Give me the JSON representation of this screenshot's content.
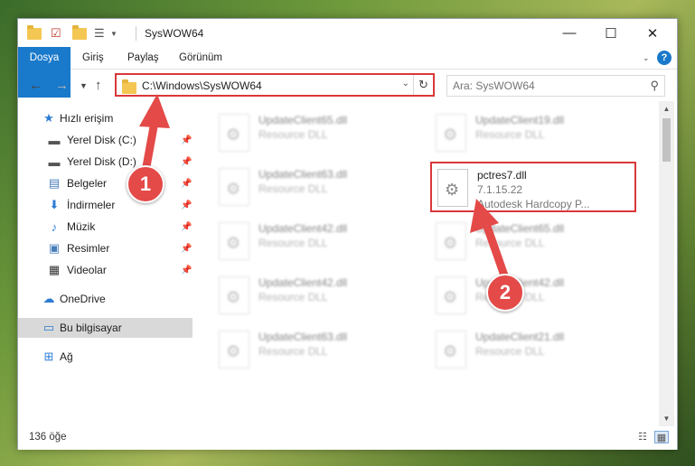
{
  "window": {
    "title": "SysWOW64"
  },
  "ribbon": {
    "tabs": [
      "Dosya",
      "Giriş",
      "Paylaş",
      "Görünüm"
    ]
  },
  "address": {
    "path": "C:\\Windows\\SysWOW64"
  },
  "search": {
    "placeholder": "Ara: SysWOW64"
  },
  "nav_pane": {
    "items": [
      {
        "label": "Hızlı erişim",
        "icon": "star-icon"
      },
      {
        "label": "Yerel Disk (C:)",
        "icon": "drive-icon"
      },
      {
        "label": "Yerel Disk (D:)",
        "icon": "drive-icon"
      },
      {
        "label": "Belgeler",
        "icon": "documents-icon"
      },
      {
        "label": "İndirmeler",
        "icon": "download-icon"
      },
      {
        "label": "Müzik",
        "icon": "music-icon"
      },
      {
        "label": "Resimler",
        "icon": "pictures-icon"
      },
      {
        "label": "Videolar",
        "icon": "video-icon"
      },
      {
        "label": "OneDrive",
        "icon": "cloud-icon"
      },
      {
        "label": "Bu bilgisayar",
        "icon": "computer-icon"
      },
      {
        "label": "Ağ",
        "icon": "network-icon"
      }
    ]
  },
  "files": [
    {
      "name": "UpdateClient65.dll",
      "type": "Resource DLL"
    },
    {
      "name": "UpdateClient19.dll",
      "type": "Resource DLL"
    },
    {
      "name": "UpdateClient63.dll",
      "type": "Resource DLL"
    },
    {
      "name": "pctres7.dll",
      "version": "7.1.15.22",
      "desc": "Autodesk Hardcopy P..."
    },
    {
      "name": "UpdateClient42.dll",
      "type": "Resource DLL"
    },
    {
      "name": "UpdateClient65.dll",
      "type": "Resource DLL"
    },
    {
      "name": "UpdateClient42.dll",
      "type": "Resource DLL"
    },
    {
      "name": "UpdateClient42.dll",
      "type": "Resource DLL"
    },
    {
      "name": "UpdateClient63.dll",
      "type": "Resource DLL"
    },
    {
      "name": "UpdateClient21.dll",
      "type": "Resource DLL"
    }
  ],
  "status": {
    "count": "136 öğe"
  },
  "annotations": {
    "step1": "1",
    "step2": "2"
  },
  "colors": {
    "accent": "#1979ca",
    "highlight": "#d9383a",
    "badge": "#e34a48"
  }
}
